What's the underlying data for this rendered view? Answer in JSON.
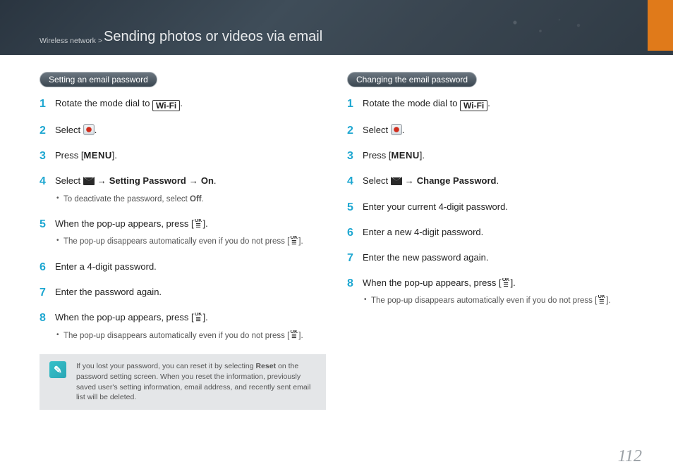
{
  "header": {
    "breadcrumb": "Wireless network > ",
    "title": "Sending photos or videos via email"
  },
  "left": {
    "section_title": "Setting an email password",
    "steps": {
      "s1_a": "Rotate the mode dial to ",
      "s1_b": ".",
      "s2_a": "Select ",
      "s2_b": ".",
      "s3_a": "Press [",
      "s3_menu": "MENU",
      "s3_b": "].",
      "s4_a": "Select ",
      "s4_arrow": "→",
      "s4_bold1": "Setting Password",
      "s4_arrow2": "→",
      "s4_bold2": "On",
      "s4_b": ".",
      "s4_sub_a": "To deactivate the password, select ",
      "s4_sub_bold": "Off",
      "s4_sub_b": ".",
      "s5_a": "When the pop-up appears, press [",
      "s5_b": "].",
      "s5_sub_a": "The pop-up disappears automatically even if you do not press [",
      "s5_sub_b": "].",
      "s6": "Enter a 4-digit password.",
      "s7": "Enter the password again.",
      "s8_a": "When the pop-up appears, press [",
      "s8_b": "].",
      "s8_sub_a": "The pop-up disappears automatically even if you do not press [",
      "s8_sub_b": "]."
    },
    "note_a": "If you lost your password, you can reset it by selecting ",
    "note_bold": "Reset",
    "note_b": " on the password setting screen. When you reset the information, previously saved user's setting information, email address, and recently sent email list will be deleted."
  },
  "right": {
    "section_title": "Changing the email password",
    "steps": {
      "s1_a": "Rotate the mode dial to ",
      "s1_b": ".",
      "s2_a": "Select ",
      "s2_b": ".",
      "s3_a": "Press [",
      "s3_menu": "MENU",
      "s3_b": "].",
      "s4_a": "Select ",
      "s4_arrow": "→",
      "s4_bold": "Change Password",
      "s4_b": ".",
      "s5": "Enter your current 4-digit password.",
      "s6": "Enter a new 4-digit password.",
      "s7": "Enter the new password again.",
      "s8_a": "When the pop-up appears, press [",
      "s8_b": "].",
      "s8_sub_a": "The pop-up disappears automatically even if you do not press [",
      "s8_sub_b": "]."
    }
  },
  "page_number": "112",
  "icons": {
    "wifi_text": "Wi-Fi",
    "note_glyph": "✎"
  }
}
